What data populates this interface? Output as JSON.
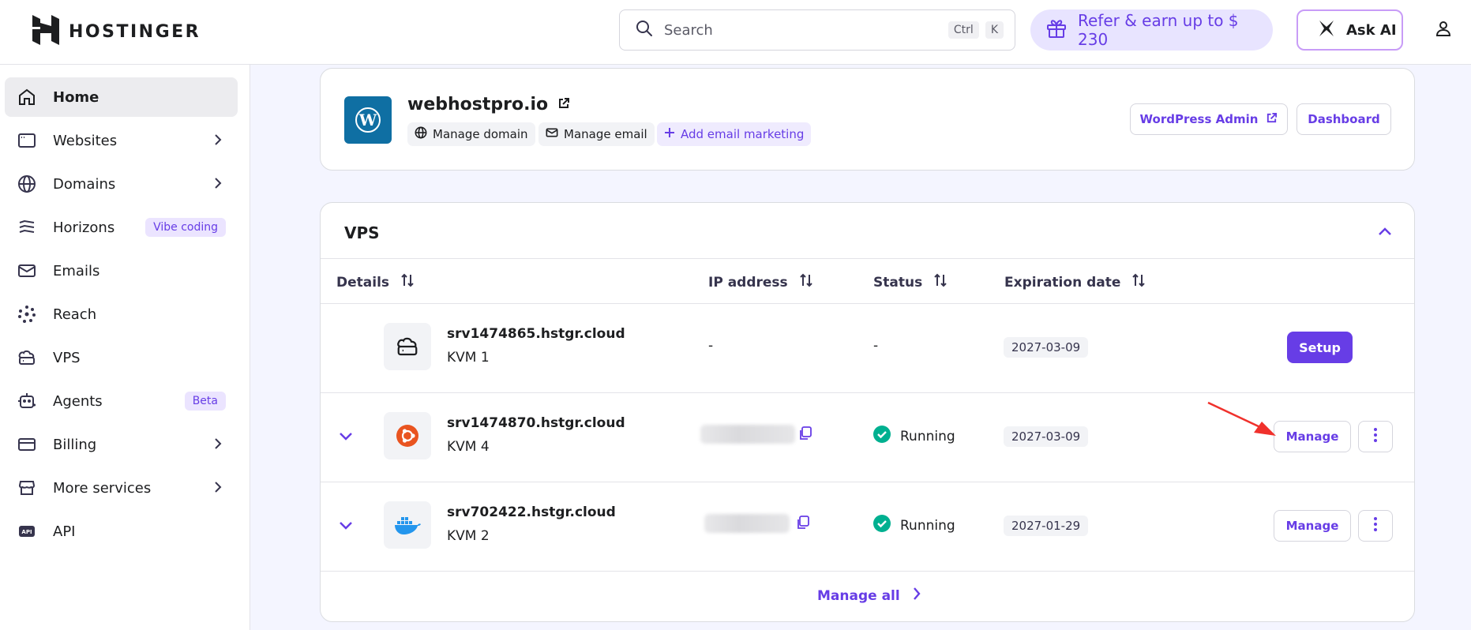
{
  "header": {
    "logo_text": "HOSTINGER",
    "search": {
      "placeholder": "Search",
      "shortcut_key1": "Ctrl",
      "shortcut_key2": "K"
    },
    "refer_label": "Refer & earn up to $ 230",
    "ask_ai_label": "Ask AI",
    "icons": [
      "hostinger-logo-icon",
      "search-icon",
      "gift-icon",
      "ask-ai-icon",
      "user-icon"
    ]
  },
  "sidebar": {
    "items": [
      {
        "label": "Home",
        "icon": "home-icon",
        "active": true
      },
      {
        "label": "Websites",
        "icon": "browser-icon",
        "chevron": true
      },
      {
        "label": "Domains",
        "icon": "globe-icon",
        "chevron": true
      },
      {
        "label": "Horizons",
        "icon": "horizons-icon",
        "badge": "Vibe coding"
      },
      {
        "label": "Emails",
        "icon": "mail-icon"
      },
      {
        "label": "Reach",
        "icon": "reach-icon"
      },
      {
        "label": "VPS",
        "icon": "cloud-server-icon"
      },
      {
        "label": "Agents",
        "icon": "agent-icon",
        "badge": "Beta"
      },
      {
        "label": "Billing",
        "icon": "card-icon",
        "chevron": true
      },
      {
        "label": "More services",
        "icon": "store-icon",
        "chevron": true
      },
      {
        "label": "API",
        "icon": "api-icon"
      }
    ]
  },
  "site": {
    "name": "webhostpro.io",
    "chips": {
      "manage_domain": "Manage domain",
      "manage_email": "Manage email",
      "add_email_marketing": "Add email marketing"
    },
    "wordpress_admin": "WordPress Admin",
    "dashboard": "Dashboard"
  },
  "vps": {
    "title": "VPS",
    "columns": {
      "details": "Details",
      "ip": "IP address",
      "status": "Status",
      "expiration": "Expiration date"
    },
    "rows": [
      {
        "name": "srv1474865.hstgr.cloud",
        "plan": "KVM 1",
        "ip": "-",
        "status": "-",
        "expiration": "2027-03-09",
        "action": "Setup",
        "os_icon": "cloud-server-icon"
      },
      {
        "name": "srv1474870.hstgr.cloud",
        "plan": "KVM 4",
        "status": "Running",
        "expiration": "2027-03-09",
        "action": "Manage",
        "os_icon": "ubuntu-icon"
      },
      {
        "name": "srv702422.hstgr.cloud",
        "plan": "KVM 2",
        "status": "Running",
        "expiration": "2027-01-29",
        "action": "Manage",
        "os_icon": "docker-icon"
      }
    ],
    "manage_all": "Manage all"
  },
  "colors": {
    "accent": "#673de6",
    "running_green": "#00b090",
    "ubuntu_orange": "#e95420",
    "docker_blue": "#2496ed",
    "wordpress_blue": "#0f6fa3",
    "annotation_red": "#f0312c"
  }
}
